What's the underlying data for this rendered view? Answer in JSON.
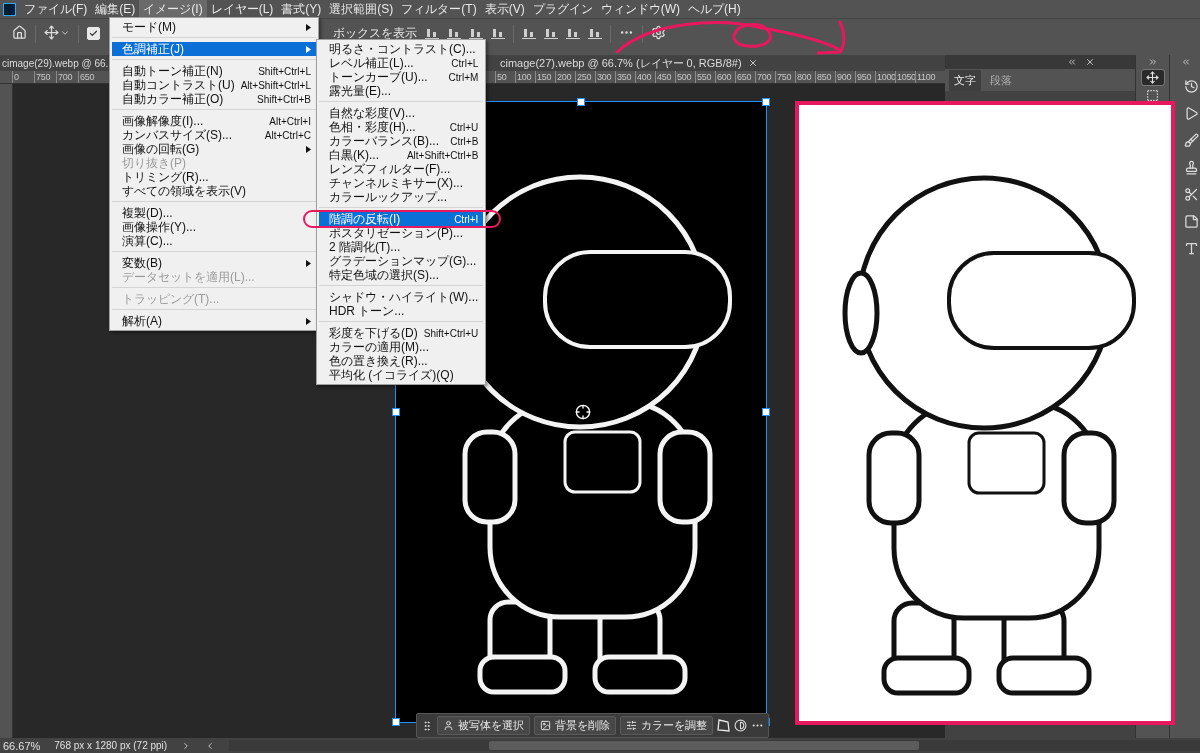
{
  "menubar": {
    "items": [
      {
        "label": "ファイル(F)",
        "selected": false
      },
      {
        "label": "編集(E)",
        "selected": false
      },
      {
        "label": "イメージ(I)",
        "selected": true
      },
      {
        "label": "レイヤー(L)",
        "selected": false
      },
      {
        "label": "書式(Y)",
        "selected": false
      },
      {
        "label": "選択範囲(S)",
        "selected": false
      },
      {
        "label": "フィルター(T)",
        "selected": false
      },
      {
        "label": "表示(V)",
        "selected": false
      },
      {
        "label": "プラグイン",
        "selected": false
      },
      {
        "label": "ウィンドウ(W)",
        "selected": false
      },
      {
        "label": "ヘルプ(H)",
        "selected": false
      }
    ]
  },
  "options_bar": {
    "checkbox": {
      "checked": true
    },
    "text": "ボックスを表示"
  },
  "documents": [
    {
      "tab": "cimage(29).webp @ 66.",
      "ruler": [
        "0",
        "750",
        "700",
        "650"
      ]
    },
    {
      "tab": "cimage(27).webp @ 66.7% (レイヤー 0, RGB/8#)",
      "closable": true,
      "ruler": [
        "50",
        "100",
        "150",
        "200",
        "250",
        "300",
        "350",
        "400",
        "450",
        "500",
        "550",
        "600",
        "650",
        "700",
        "750",
        "800",
        "850",
        "900",
        "950",
        "1000",
        "1050",
        "1100"
      ]
    }
  ],
  "image_menu": {
    "sections": [
      [
        {
          "label": "モード(M)",
          "has_submenu": true,
          "disabled": false,
          "selected": false
        }
      ],
      [
        {
          "label": "色調補正(J)",
          "has_submenu": true,
          "disabled": false,
          "selected": true
        }
      ],
      [
        {
          "label": "自動トーン補正(N)",
          "shortcut": "Shift+Ctrl+L",
          "has_submenu": false,
          "disabled": false,
          "selected": false
        },
        {
          "label": "自動コントラスト(U)",
          "shortcut": "Alt+Shift+Ctrl+L",
          "has_submenu": false,
          "disabled": false,
          "selected": false
        },
        {
          "label": "自動カラー補正(O)",
          "shortcut": "Shift+Ctrl+B",
          "has_submenu": false,
          "disabled": false,
          "selected": false
        }
      ],
      [
        {
          "label": "画像解像度(I)...",
          "shortcut": "Alt+Ctrl+I",
          "has_submenu": false,
          "disabled": false,
          "selected": false
        },
        {
          "label": "カンバスサイズ(S)...",
          "shortcut": "Alt+Ctrl+C",
          "has_submenu": false,
          "disabled": false,
          "selected": false
        },
        {
          "label": "画像の回転(G)",
          "has_submenu": true,
          "disabled": false,
          "selected": false
        },
        {
          "label": "切り抜き(P)",
          "has_submenu": false,
          "disabled": true,
          "selected": false
        },
        {
          "label": "トリミング(R)...",
          "has_submenu": false,
          "disabled": false,
          "selected": false
        },
        {
          "label": "すべての領域を表示(V)",
          "has_submenu": false,
          "disabled": false,
          "selected": false
        }
      ],
      [
        {
          "label": "複製(D)...",
          "has_submenu": false,
          "disabled": false,
          "selected": false
        },
        {
          "label": "画像操作(Y)...",
          "has_submenu": false,
          "disabled": false,
          "selected": false
        },
        {
          "label": "演算(C)...",
          "has_submenu": false,
          "disabled": false,
          "selected": false
        }
      ],
      [
        {
          "label": "変数(B)",
          "has_submenu": true,
          "disabled": false,
          "selected": false
        },
        {
          "label": "データセットを適用(L)...",
          "has_submenu": false,
          "disabled": true,
          "selected": false
        }
      ],
      [
        {
          "label": "トラッピング(T)...",
          "has_submenu": false,
          "disabled": true,
          "selected": false
        }
      ],
      [
        {
          "label": "解析(A)",
          "has_submenu": true,
          "disabled": false,
          "selected": false
        }
      ]
    ]
  },
  "adjustments_menu": {
    "sections": [
      [
        {
          "label": "明るさ・コントラスト(C)...",
          "has_submenu": false,
          "disabled": false,
          "selected": false
        },
        {
          "label": "レベル補正(L)...",
          "shortcut": "Ctrl+L",
          "has_submenu": false,
          "disabled": false,
          "selected": false
        },
        {
          "label": "トーンカーブ(U)...",
          "shortcut": "Ctrl+M",
          "has_submenu": false,
          "disabled": false,
          "selected": false
        },
        {
          "label": "露光量(E)...",
          "has_submenu": false,
          "disabled": false,
          "selected": false
        }
      ],
      [
        {
          "label": "自然な彩度(V)...",
          "has_submenu": false,
          "disabled": false,
          "selected": false
        },
        {
          "label": "色相・彩度(H)...",
          "shortcut": "Ctrl+U",
          "has_submenu": false,
          "disabled": false,
          "selected": false
        },
        {
          "label": "カラーバランス(B)...",
          "shortcut": "Ctrl+B",
          "has_submenu": false,
          "disabled": false,
          "selected": false
        },
        {
          "label": "白黒(K)...",
          "shortcut": "Alt+Shift+Ctrl+B",
          "has_submenu": false,
          "disabled": false,
          "selected": false
        },
        {
          "label": "レンズフィルター(F)...",
          "has_submenu": false,
          "disabled": false,
          "selected": false
        },
        {
          "label": "チャンネルミキサー(X)...",
          "has_submenu": false,
          "disabled": false,
          "selected": false
        },
        {
          "label": "カラールックアップ...",
          "has_submenu": false,
          "disabled": false,
          "selected": false
        }
      ],
      [
        {
          "label": "階調の反転(I)",
          "shortcut": "Ctrl+I",
          "has_submenu": false,
          "disabled": false,
          "selected": true
        },
        {
          "label": "ポスタリゼーション(P)...",
          "has_submenu": false,
          "disabled": false,
          "selected": false
        },
        {
          "label": "2 階調化(T)...",
          "has_submenu": false,
          "disabled": false,
          "selected": false
        },
        {
          "label": "グラデーションマップ(G)...",
          "has_submenu": false,
          "disabled": false,
          "selected": false
        },
        {
          "label": "特定色域の選択(S)...",
          "has_submenu": false,
          "disabled": false,
          "selected": false
        }
      ],
      [
        {
          "label": "シャドウ・ハイライト(W)...",
          "has_submenu": false,
          "disabled": false,
          "selected": false
        },
        {
          "label": "HDR トーン...",
          "has_submenu": false,
          "disabled": false,
          "selected": false
        }
      ],
      [
        {
          "label": "彩度を下げる(D)",
          "shortcut": "Shift+Ctrl+U",
          "has_submenu": false,
          "disabled": false,
          "selected": false
        },
        {
          "label": "カラーの適用(M)...",
          "has_submenu": false,
          "disabled": false,
          "selected": false
        },
        {
          "label": "色の置き換え(R)...",
          "has_submenu": false,
          "disabled": false,
          "selected": false
        },
        {
          "label": "平均化 (イコライズ)(Q)",
          "has_submenu": false,
          "disabled": false,
          "selected": false
        }
      ]
    ]
  },
  "context_bar": {
    "buttons": [
      {
        "label": "被写体を選択"
      },
      {
        "label": "背景を削除"
      },
      {
        "label": "カラーを調整"
      }
    ]
  },
  "panel": {
    "tabs": [
      {
        "label": "文字",
        "selected": true
      },
      {
        "label": "段落",
        "selected": false
      }
    ]
  },
  "tools": [
    {
      "selected": true
    },
    {
      "selected": false
    }
  ],
  "status_bar": {
    "zoom": "66.67%",
    "size": "768 px x 1280 px (72 ppi)"
  }
}
